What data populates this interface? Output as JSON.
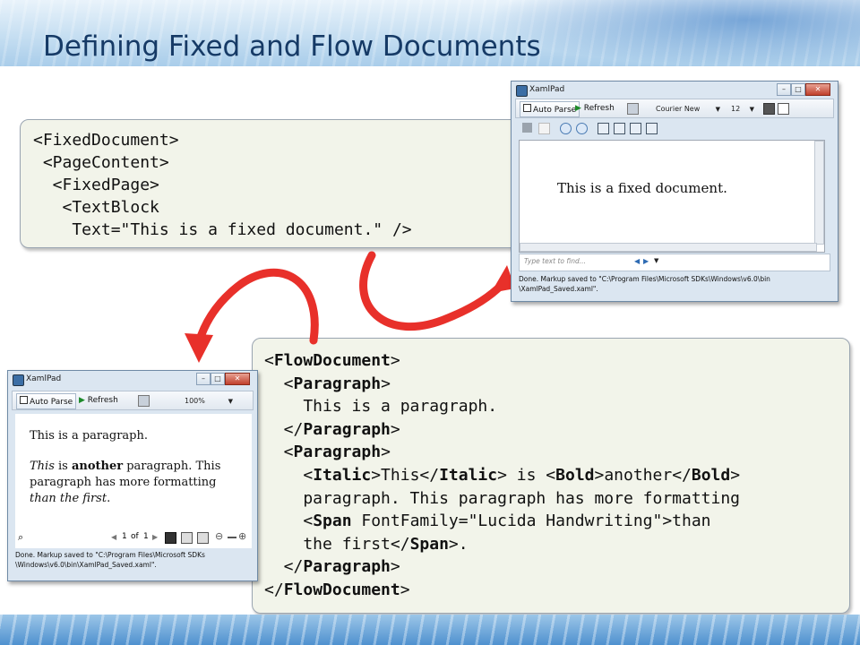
{
  "slide": {
    "title": "Defining Fixed and Flow Documents"
  },
  "fixed_code": {
    "lines": [
      "<FixedDocument>",
      " <PageContent>",
      "  <FixedPage>",
      "   <TextBlock",
      "    Text=\"This is a fixed document.\" />"
    ]
  },
  "flow_code": {
    "l1_open": "<",
    "l1_tag": "FlowDocument",
    "l1_close": ">",
    "l2_open": "  <",
    "l2_tag": "Paragraph",
    "l2_close": ">",
    "l3": "    This is a paragraph.",
    "l4_open": "  </",
    "l4_tag": "Paragraph",
    "l4_close": ">",
    "l5_open": "  <",
    "l5_tag": "Paragraph",
    "l5_close": ">",
    "l6_a": "    <",
    "l6_italic": "Italic",
    "l6_b": ">This</",
    "l6_italic2": "Italic",
    "l6_c": "> is <",
    "l6_bold": "Bold",
    "l6_d": ">another</",
    "l6_bold2": "Bold",
    "l6_e": ">",
    "l7": "    paragraph. This paragraph has more formatting",
    "l8_a": "    <",
    "l8_span": "Span",
    "l8_b": " FontFamily=\"Lucida Handwriting\">than",
    "l9_a": "    the first</",
    "l9_span": "Span",
    "l9_b": ">.",
    "l10_open": "  </",
    "l10_tag": "Paragraph",
    "l10_close": ">",
    "l11_open": "</",
    "l11_tag": "FlowDocument",
    "l11_close": ">"
  },
  "xamlpad_fixed": {
    "title": "XamlPad",
    "auto_parse": "Auto Parse",
    "refresh": "Refresh",
    "font": "Courier New",
    "font_size": "12",
    "document_text": "This is a fixed document.",
    "find_placeholder": "Type text to find...",
    "status_line1": "Done. Markup saved to \"C:\\Program Files\\Microsoft SDKs\\Windows\\v6.0\\bin",
    "status_line2": "\\XamlPad_Saved.xaml\"."
  },
  "xamlpad_flow": {
    "title": "XamlPad",
    "auto_parse": "Auto Parse",
    "refresh": "Refresh",
    "zoom": "100%",
    "para1": "This is a paragraph.",
    "para2_italic": "This",
    "para2_is": " is ",
    "para2_bold": "another",
    "para2_rest": " paragraph. This",
    "para2_line2": "paragraph has more formatting",
    "para2_hand": "than the first",
    "para2_end": ".",
    "page_current": "1",
    "page_of": "of",
    "page_total": "1",
    "status_line1": "Done. Markup saved to \"C:\\Program Files\\Microsoft SDKs",
    "status_line2": "\\Windows\\v6.0\\bin\\XamlPad_Saved.xaml\"."
  },
  "colors": {
    "arrow": "#e8302a",
    "title": "#163a66",
    "code_bg": "#f2f4ea"
  }
}
